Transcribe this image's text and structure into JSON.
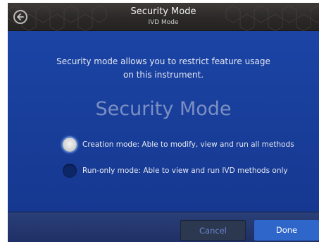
{
  "header": {
    "title": "Security Mode",
    "subtitle": "IVD Mode",
    "back_icon": "back-arrow-icon"
  },
  "main": {
    "description_line1": "Security mode allows you to restrict feature usage",
    "description_line2": "on this instrument.",
    "heading": "Security Mode",
    "options": [
      {
        "label": "Creation mode: Able to modify, view and run all methods",
        "selected": true
      },
      {
        "label": "Run-only mode: Able to view and run IVD methods only",
        "selected": false
      }
    ]
  },
  "footer": {
    "cancel_label": "Cancel",
    "done_label": "Done"
  },
  "colors": {
    "background": "#1a3f9b",
    "header": "#2b2927",
    "primary_button": "#2f66c9",
    "secondary_button": "#2c3850"
  }
}
